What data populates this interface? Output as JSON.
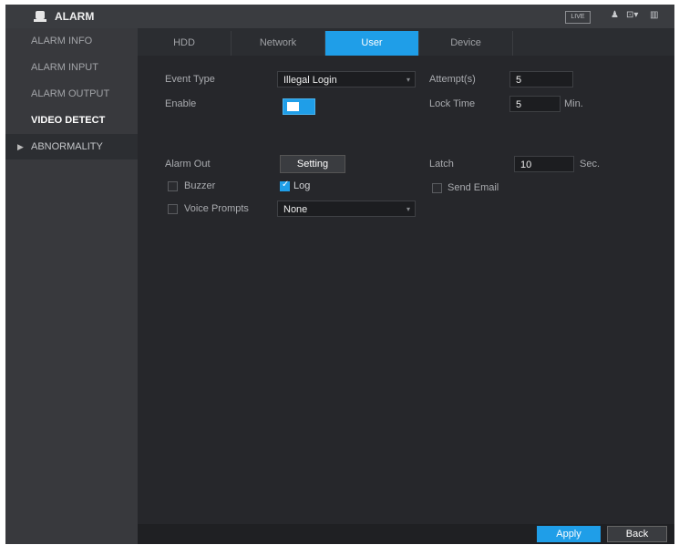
{
  "header": {
    "title": "ALARM",
    "live_badge": "LIVE"
  },
  "sidebar": {
    "items": [
      {
        "label": "ALARM INFO"
      },
      {
        "label": "ALARM INPUT"
      },
      {
        "label": "ALARM OUTPUT"
      },
      {
        "label": "VIDEO DETECT"
      },
      {
        "label": "ABNORMALITY"
      }
    ]
  },
  "tabs": [
    {
      "label": "HDD"
    },
    {
      "label": "Network"
    },
    {
      "label": "User"
    },
    {
      "label": "Device"
    }
  ],
  "form": {
    "event_type_label": "Event Type",
    "event_type_value": "Illegal Login",
    "enable_label": "Enable",
    "attempts_label": "Attempt(s)",
    "attempts_value": "5",
    "lock_time_label": "Lock Time",
    "lock_time_value": "5",
    "lock_time_unit": "Min.",
    "alarm_out_label": "Alarm Out",
    "setting_button": "Setting",
    "latch_label": "Latch",
    "latch_value": "10",
    "latch_unit": "Sec.",
    "buzzer_label": "Buzzer",
    "log_label": "Log",
    "send_email_label": "Send Email",
    "voice_prompts_label": "Voice Prompts",
    "voice_prompts_value": "None"
  },
  "footer": {
    "apply": "Apply",
    "back": "Back"
  },
  "colors": {
    "accent": "#1f9ee8",
    "background": "#26272b",
    "sidebar": "#38393d"
  }
}
